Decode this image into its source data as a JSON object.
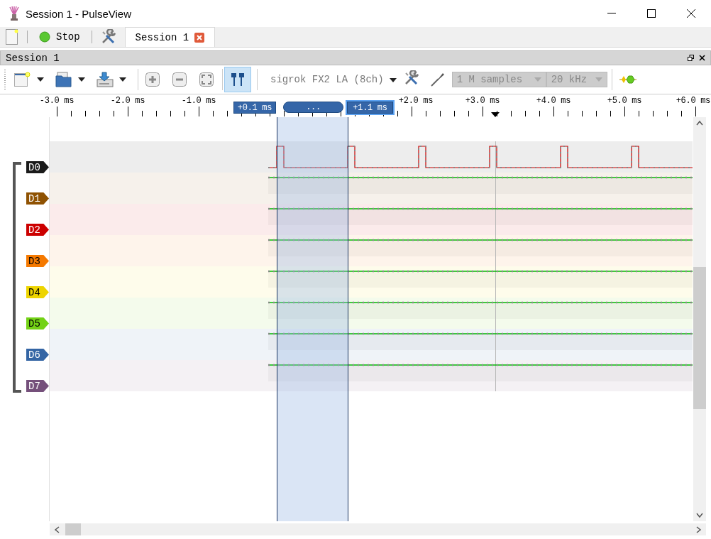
{
  "window": {
    "title": "Session 1 - PulseView"
  },
  "main_toolbar": {
    "run_button": {
      "label": "Stop"
    },
    "tabs": [
      {
        "label": "Session 1",
        "selected": true
      }
    ]
  },
  "session": {
    "title": "Session 1",
    "toolbar": {
      "cursors": {
        "selected": true
      },
      "device": "sigrok FX2 LA (8ch)",
      "sample_count": {
        "value": "1 M samples",
        "disabled": true
      },
      "sample_rate": {
        "value": "20 kHz",
        "disabled": true
      }
    }
  },
  "ruler": {
    "ticks": [
      "-3.0 ms",
      "-2.0 ms",
      "-1.0 ms",
      "+2.0 ms",
      "+3.0 ms",
      "+4.0 ms",
      "+5.0 ms",
      "+6.0 ms"
    ],
    "flags": [
      {
        "kind": "marker",
        "label": "+0.1 ms"
      },
      {
        "kind": "span",
        "label": "..."
      },
      {
        "kind": "marker",
        "label": "+1.1 ms",
        "selected": true
      }
    ]
  },
  "channels": [
    {
      "name": "D0",
      "color": "#1a1a1a"
    },
    {
      "name": "D1",
      "color": "#8f5202"
    },
    {
      "name": "D2",
      "color": "#cc0000"
    },
    {
      "name": "D3",
      "color": "#f57900"
    },
    {
      "name": "D4",
      "color": "#edd400"
    },
    {
      "name": "D5",
      "color": "#73d216"
    },
    {
      "name": "D6",
      "color": "#3465a4"
    },
    {
      "name": "D7",
      "color": "#75507b"
    }
  ]
}
